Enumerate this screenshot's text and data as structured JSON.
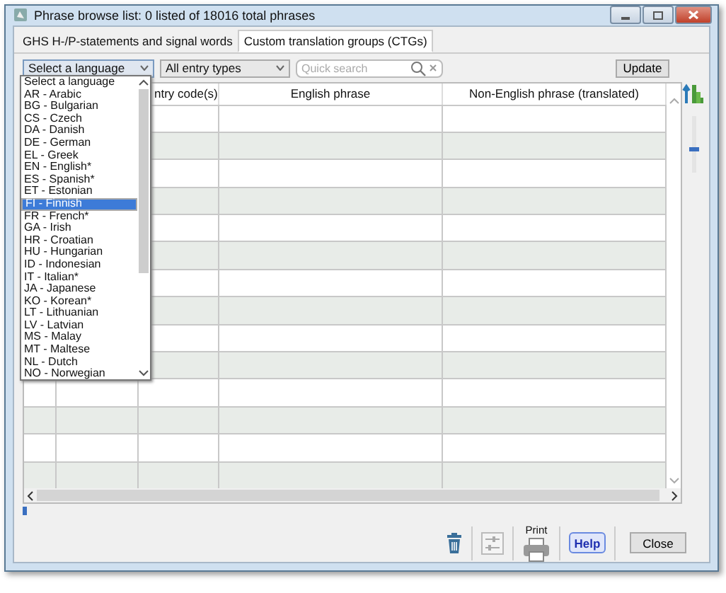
{
  "window": {
    "title": "Phrase browse list: 0 listed of 18016 total phrases"
  },
  "tabs": [
    {
      "label": "GHS H-/P-statements and signal words",
      "selected": false
    },
    {
      "label": "Custom translation groups (CTGs)",
      "selected": true
    }
  ],
  "filters": {
    "language": "Select a language",
    "entry_type": "All entry types",
    "search": {
      "placeholder": "Quick search"
    },
    "update": "Update"
  },
  "language_list": {
    "items": [
      {
        "label": "Select a language",
        "selected": false
      },
      {
        "label": "AR - Arabic",
        "selected": false
      },
      {
        "label": "BG - Bulgarian",
        "selected": false
      },
      {
        "label": "CS - Czech",
        "selected": false
      },
      {
        "label": "DA - Danish",
        "selected": false
      },
      {
        "label": "DE - German",
        "selected": false
      },
      {
        "label": "EL - Greek",
        "selected": false
      },
      {
        "label": "EN - English*",
        "selected": false
      },
      {
        "label": "ES - Spanish*",
        "selected": false
      },
      {
        "label": "ET - Estonian",
        "selected": false
      },
      {
        "label": "FI - Finnish",
        "selected": true
      },
      {
        "label": "FR - French*",
        "selected": false
      },
      {
        "label": "GA - Irish",
        "selected": false
      },
      {
        "label": "HR - Croatian",
        "selected": false
      },
      {
        "label": "HU - Hungarian",
        "selected": false
      },
      {
        "label": "ID - Indonesian",
        "selected": false
      },
      {
        "label": "IT - Italian*",
        "selected": false
      },
      {
        "label": "JA - Japanese",
        "selected": false
      },
      {
        "label": "KO - Korean*",
        "selected": false
      },
      {
        "label": "LT - Lithuanian",
        "selected": false
      },
      {
        "label": "LV - Latvian",
        "selected": false
      },
      {
        "label": "MS - Malay",
        "selected": false
      },
      {
        "label": "MT - Maltese",
        "selected": false
      },
      {
        "label": "NL - Dutch",
        "selected": false
      },
      {
        "label": "NO - Norwegian",
        "selected": false
      }
    ]
  },
  "table": {
    "headers": [
      "ntry code(s)",
      "English phrase",
      "Non-English phrase (translated)"
    ]
  },
  "side_slider": {
    "level": 0.4
  },
  "buttons": {
    "print": "Print",
    "help": "Help",
    "close": "Close"
  }
}
